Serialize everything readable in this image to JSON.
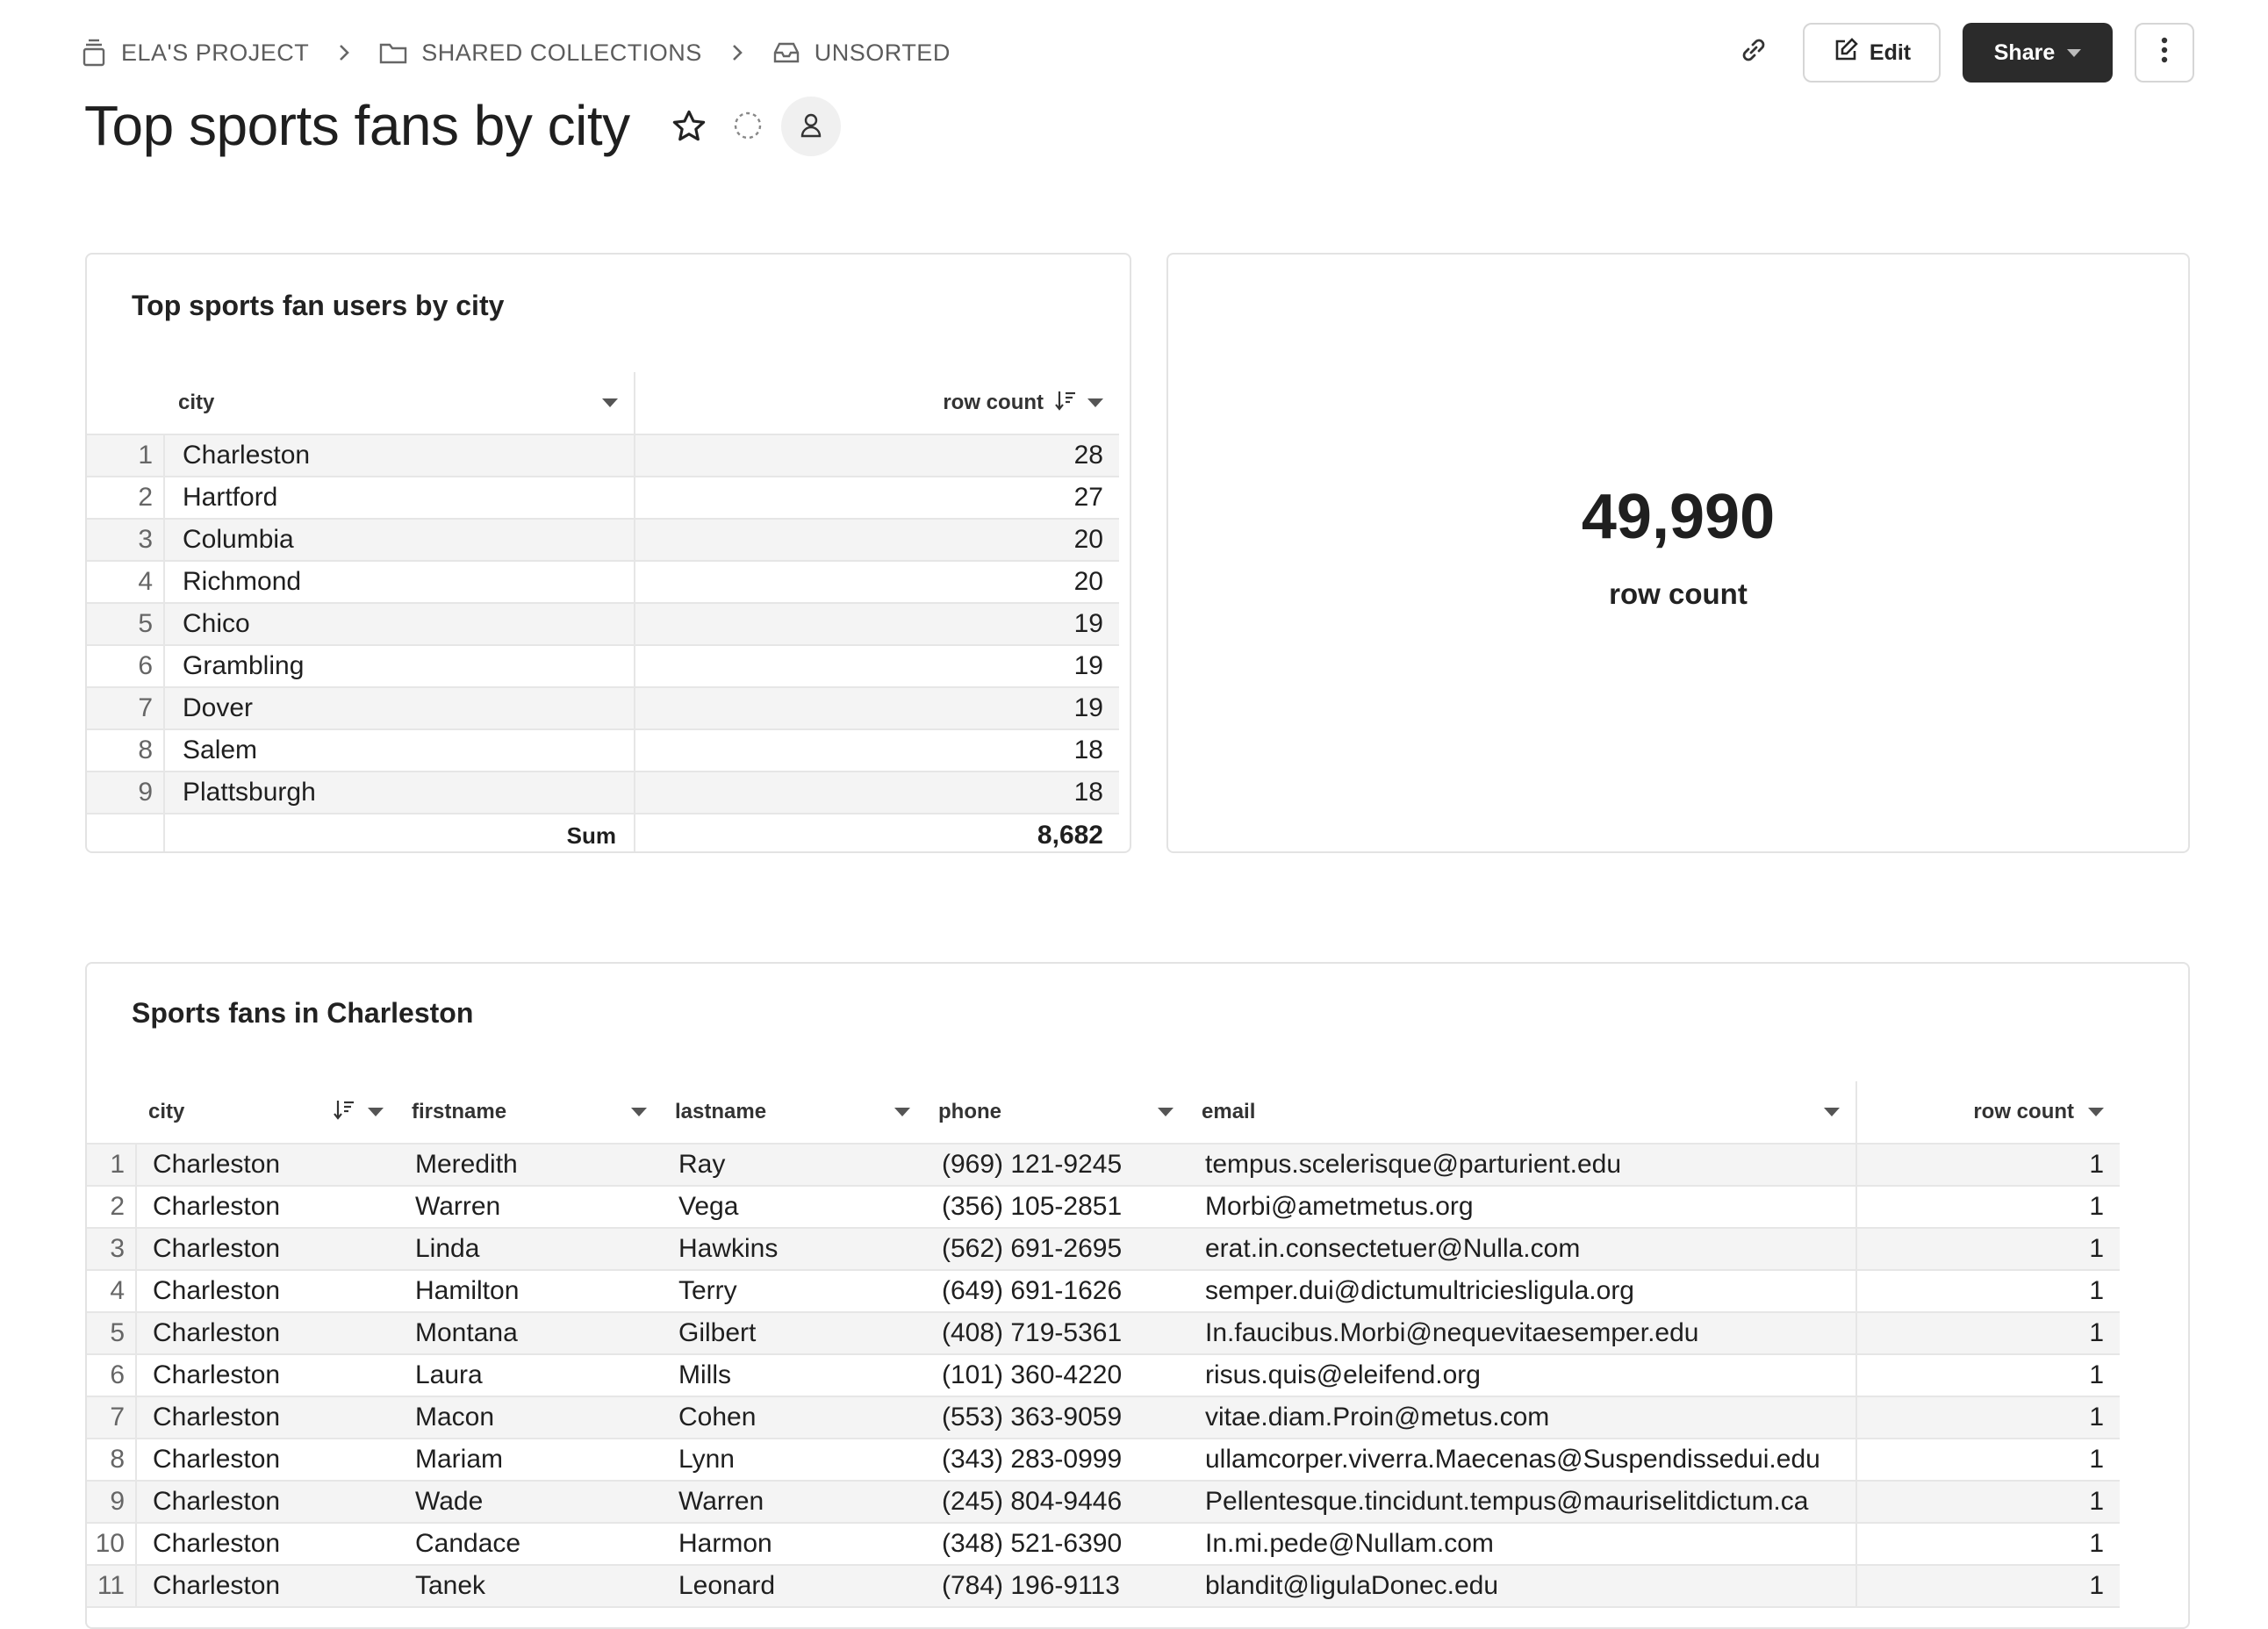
{
  "breadcrumb": [
    {
      "label": "ELA'S PROJECT",
      "icon": "project-icon"
    },
    {
      "label": "SHARED COLLECTIONS",
      "icon": "folder-icon"
    },
    {
      "label": "UNSORTED",
      "icon": "inbox-icon"
    }
  ],
  "header": {
    "title": "Top sports fans by city",
    "edit_label": "Edit",
    "share_label": "Share"
  },
  "top_table": {
    "title": "Top sports fan users by city",
    "columns": [
      "city",
      "row count"
    ],
    "rows": [
      {
        "idx": "1",
        "city": "Charleston",
        "count": "28"
      },
      {
        "idx": "2",
        "city": "Hartford",
        "count": "27"
      },
      {
        "idx": "3",
        "city": "Columbia",
        "count": "20"
      },
      {
        "idx": "4",
        "city": "Richmond",
        "count": "20"
      },
      {
        "idx": "5",
        "city": "Chico",
        "count": "19"
      },
      {
        "idx": "6",
        "city": "Grambling",
        "count": "19"
      },
      {
        "idx": "7",
        "city": "Dover",
        "count": "19"
      },
      {
        "idx": "8",
        "city": "Salem",
        "count": "18"
      },
      {
        "idx": "9",
        "city": "Plattsburgh",
        "count": "18"
      }
    ],
    "sum_label": "Sum",
    "sum_value": "8,682"
  },
  "kpi": {
    "value": "49,990",
    "label": "row count"
  },
  "fans_table": {
    "title": "Sports fans in Charleston",
    "columns": [
      "city",
      "firstname",
      "lastname",
      "phone",
      "email",
      "row count"
    ],
    "rows": [
      {
        "idx": "1",
        "city": "Charleston",
        "firstname": "Meredith",
        "lastname": "Ray",
        "phone": "(969) 121-9245",
        "email": "tempus.scelerisque@parturient.edu",
        "count": "1"
      },
      {
        "idx": "2",
        "city": "Charleston",
        "firstname": "Warren",
        "lastname": "Vega",
        "phone": "(356) 105-2851",
        "email": "Morbi@ametmetus.org",
        "count": "1"
      },
      {
        "idx": "3",
        "city": "Charleston",
        "firstname": "Linda",
        "lastname": "Hawkins",
        "phone": "(562) 691-2695",
        "email": "erat.in.consectetuer@Nulla.com",
        "count": "1"
      },
      {
        "idx": "4",
        "city": "Charleston",
        "firstname": "Hamilton",
        "lastname": "Terry",
        "phone": "(649) 691-1626",
        "email": "semper.dui@dictumultriciesligula.org",
        "count": "1"
      },
      {
        "idx": "5",
        "city": "Charleston",
        "firstname": "Montana",
        "lastname": "Gilbert",
        "phone": "(408) 719-5361",
        "email": "In.faucibus.Morbi@nequevitaesemper.edu",
        "count": "1"
      },
      {
        "idx": "6",
        "city": "Charleston",
        "firstname": "Laura",
        "lastname": "Mills",
        "phone": "(101) 360-4220",
        "email": "risus.quis@eleifend.org",
        "count": "1"
      },
      {
        "idx": "7",
        "city": "Charleston",
        "firstname": "Macon",
        "lastname": "Cohen",
        "phone": "(553) 363-9059",
        "email": "vitae.diam.Proin@metus.com",
        "count": "1"
      },
      {
        "idx": "8",
        "city": "Charleston",
        "firstname": "Mariam",
        "lastname": "Lynn",
        "phone": "(343) 283-0999",
        "email": "ullamcorper.viverra.Maecenas@Suspendissedui.edu",
        "count": "1"
      },
      {
        "idx": "9",
        "city": "Charleston",
        "firstname": "Wade",
        "lastname": "Warren",
        "phone": "(245) 804-9446",
        "email": "Pellentesque.tincidunt.tempus@mauriselitdictum.ca",
        "count": "1"
      },
      {
        "idx": "10",
        "city": "Charleston",
        "firstname": "Candace",
        "lastname": "Harmon",
        "phone": "(348) 521-6390",
        "email": "In.mi.pede@Nullam.com",
        "count": "1"
      },
      {
        "idx": "11",
        "city": "Charleston",
        "firstname": "Tanek",
        "lastname": "Leonard",
        "phone": "(784) 196-9113",
        "email": "blandit@ligulaDonec.edu",
        "count": "1"
      }
    ]
  }
}
